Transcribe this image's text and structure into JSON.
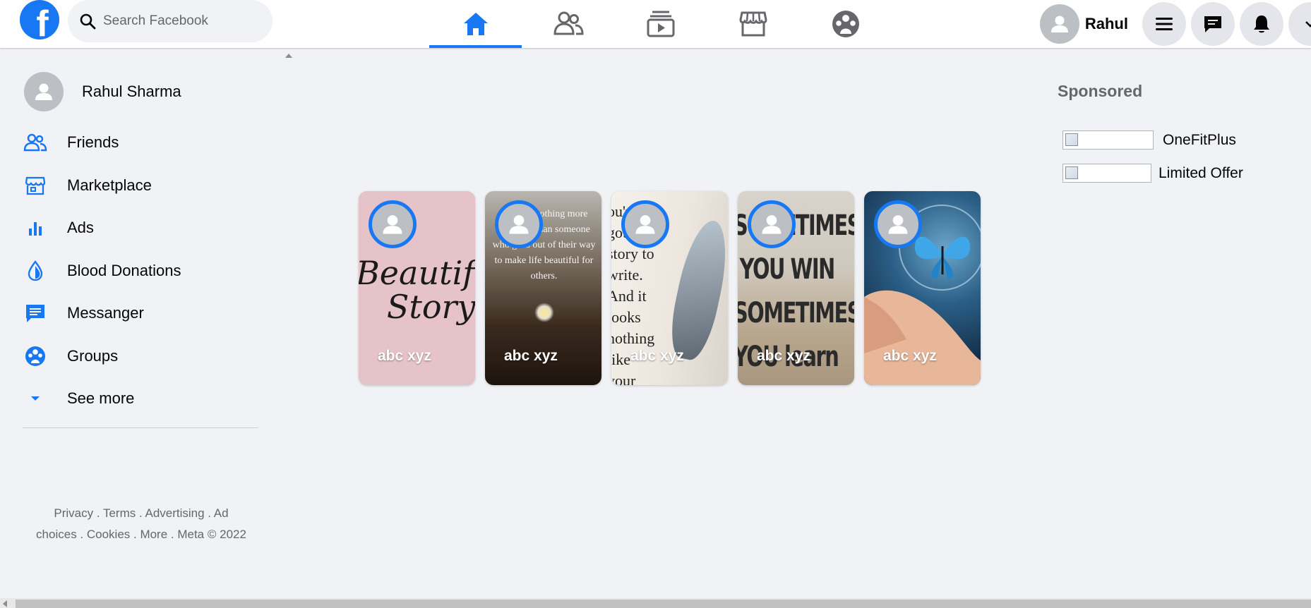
{
  "header": {
    "logo_letter": "f",
    "search_placeholder": "Search Facebook",
    "nav_tabs": [
      {
        "name": "home",
        "icon": "home-icon",
        "active": true
      },
      {
        "name": "friends",
        "icon": "friends-icon",
        "active": false
      },
      {
        "name": "watch",
        "icon": "watch-icon",
        "active": false
      },
      {
        "name": "marketplace",
        "icon": "marketplace-icon",
        "active": false
      },
      {
        "name": "groups",
        "icon": "groups-icon",
        "active": false
      }
    ],
    "user_name": "Rahul",
    "buttons": [
      "menu-icon",
      "messenger-icon",
      "notifications-icon",
      "account-icon"
    ]
  },
  "sidebar": {
    "profile_name": "Rahul Sharma",
    "items": [
      {
        "label": "Friends",
        "icon": "friends-icon"
      },
      {
        "label": "Marketplace",
        "icon": "marketplace-icon"
      },
      {
        "label": "Ads",
        "icon": "ads-bar-chart-icon"
      },
      {
        "label": "Blood Donations",
        "icon": "blood-drop-icon"
      },
      {
        "label": "Messanger",
        "icon": "messenger-icon"
      },
      {
        "label": "Groups",
        "icon": "groups-icon"
      },
      {
        "label": "See more",
        "icon": "chevron-down-icon"
      }
    ],
    "footer_line1": "Privacy . Terms . Advertising . Ad",
    "footer_line2": "choices . Cookies . More . Meta © 2022"
  },
  "stories": [
    {
      "name": "abc xyz",
      "art": "Beautiful Story"
    },
    {
      "name": "abc xyz",
      "art": "There is nothing more beautiful than someone who goes out of their way to make life beautiful for others."
    },
    {
      "name": "abc xyz",
      "art": "You've got a story to write. And it looks nothing like your past."
    },
    {
      "name": "abc xyz",
      "art": "SOMETIMES YOU WIN SOMETIMES YOU learn"
    },
    {
      "name": "abc xyz",
      "art": "butterfly in hand"
    }
  ],
  "sponsored": {
    "title": "Sponsored",
    "ads": [
      {
        "label": "OneFitPlus"
      },
      {
        "label": "Limited Offer"
      }
    ]
  },
  "colors": {
    "brand": "#1877f2",
    "background": "#f0f2f5"
  }
}
